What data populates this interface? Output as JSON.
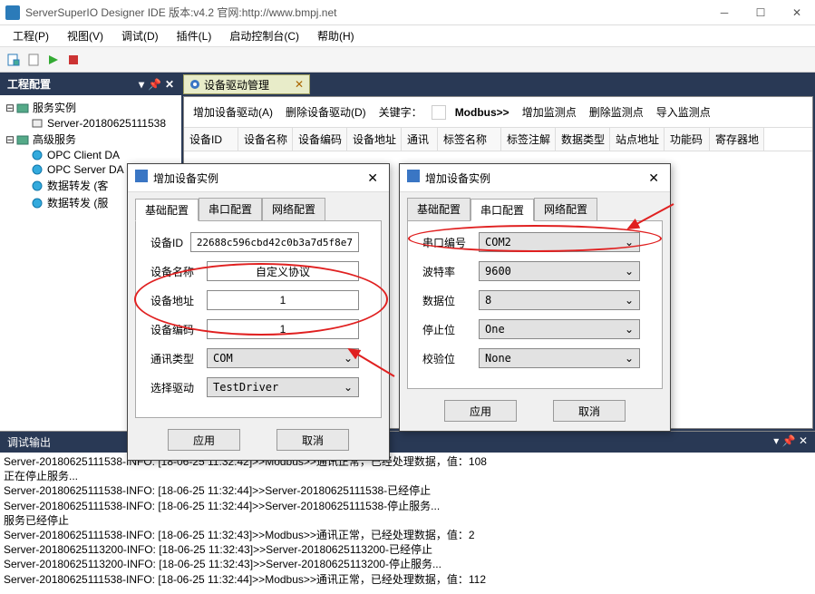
{
  "title": "ServerSuperIO Designer IDE 版本:v4.2 官网:http://www.bmpj.net",
  "menu": {
    "project": "工程(P)",
    "view": "视图(V)",
    "debug": "调试(D)",
    "plugin": "插件(L)",
    "console": "启动控制台(C)",
    "help": "帮助(H)"
  },
  "side": {
    "title": "工程配置",
    "items": {
      "root": "服务实例",
      "server": "Server-20180625111538",
      "adv": "高级服务",
      "opc_da": "OPC Client DA",
      "opc_server": "OPC Server DA",
      "fwd1": "数据转发 (客",
      "fwd2": "数据转发 (服"
    }
  },
  "doc": {
    "tab": "设备驱动管理"
  },
  "ops": {
    "add_drv": "增加设备驱动(A)",
    "del_drv": "删除设备驱动(D)",
    "kw": "关键字：",
    "modbus": "Modbus>>",
    "add_mp": "增加监测点",
    "del_mp": "删除监测点",
    "imp_mp": "导入监测点"
  },
  "grid": {
    "c1": "设备ID",
    "c2": "设备名称",
    "c3": "设备编码",
    "c4": "设备地址",
    "c5": "通讯",
    "c6": "标签名称",
    "c7": "标签注解",
    "c8": "数据类型",
    "c9": "站点地址",
    "c10": "功能码",
    "c11": "寄存器地"
  },
  "dlg1": {
    "title": "增加设备实例",
    "tabs": {
      "t1": "基础配置",
      "t2": "串口配置",
      "t3": "网络配置"
    },
    "rows": {
      "id_lbl": "设备ID",
      "id_val": "22688c596cbd42c0b3a7d5f8e7",
      "name_lbl": "设备名称",
      "name_val": "自定义协议",
      "addr_lbl": "设备地址",
      "addr_val": "1",
      "code_lbl": "设备编码",
      "code_val": "1",
      "comm_lbl": "通讯类型",
      "comm_val": "COM",
      "drv_lbl": "选择驱动",
      "drv_val": "TestDriver"
    },
    "apply": "应用",
    "cancel": "取消"
  },
  "dlg2": {
    "title": "增加设备实例",
    "tabs": {
      "t1": "基础配置",
      "t2": "串口配置",
      "t3": "网络配置"
    },
    "rows": {
      "port_lbl": "串口编号",
      "port_val": "COM2",
      "baud_lbl": "波特率",
      "baud_val": "9600",
      "data_lbl": "数据位",
      "data_val": "8",
      "stop_lbl": "停止位",
      "stop_val": "One",
      "parity_lbl": "校验位",
      "parity_val": "None"
    },
    "apply": "应用",
    "cancel": "取消"
  },
  "output": {
    "title": "调试输出",
    "lines": [
      "Server-20180625111538-INFO: [18-06-25 11:32:42]>>Modbus>>通讯正常，已经处理数据，值：108",
      "正在停止服务...",
      "Server-20180625111538-INFO: [18-06-25 11:32:44]>>Server-20180625111538-已经停止",
      "Server-20180625111538-INFO: [18-06-25 11:32:44]>>Server-20180625111538-停止服务...",
      "服务已经停止",
      "Server-20180625111538-INFO: [18-06-25 11:32:43]>>Modbus>>通讯正常，已经处理数据，值：2",
      "Server-20180625113200-INFO: [18-06-25 11:32:43]>>Server-20180625113200-已经停止",
      "Server-20180625113200-INFO: [18-06-25 11:32:43]>>Server-20180625113200-停止服务...",
      "Server-20180625111538-INFO: [18-06-25 11:32:44]>>Modbus>>通讯正常，已经处理数据，值：112"
    ]
  }
}
